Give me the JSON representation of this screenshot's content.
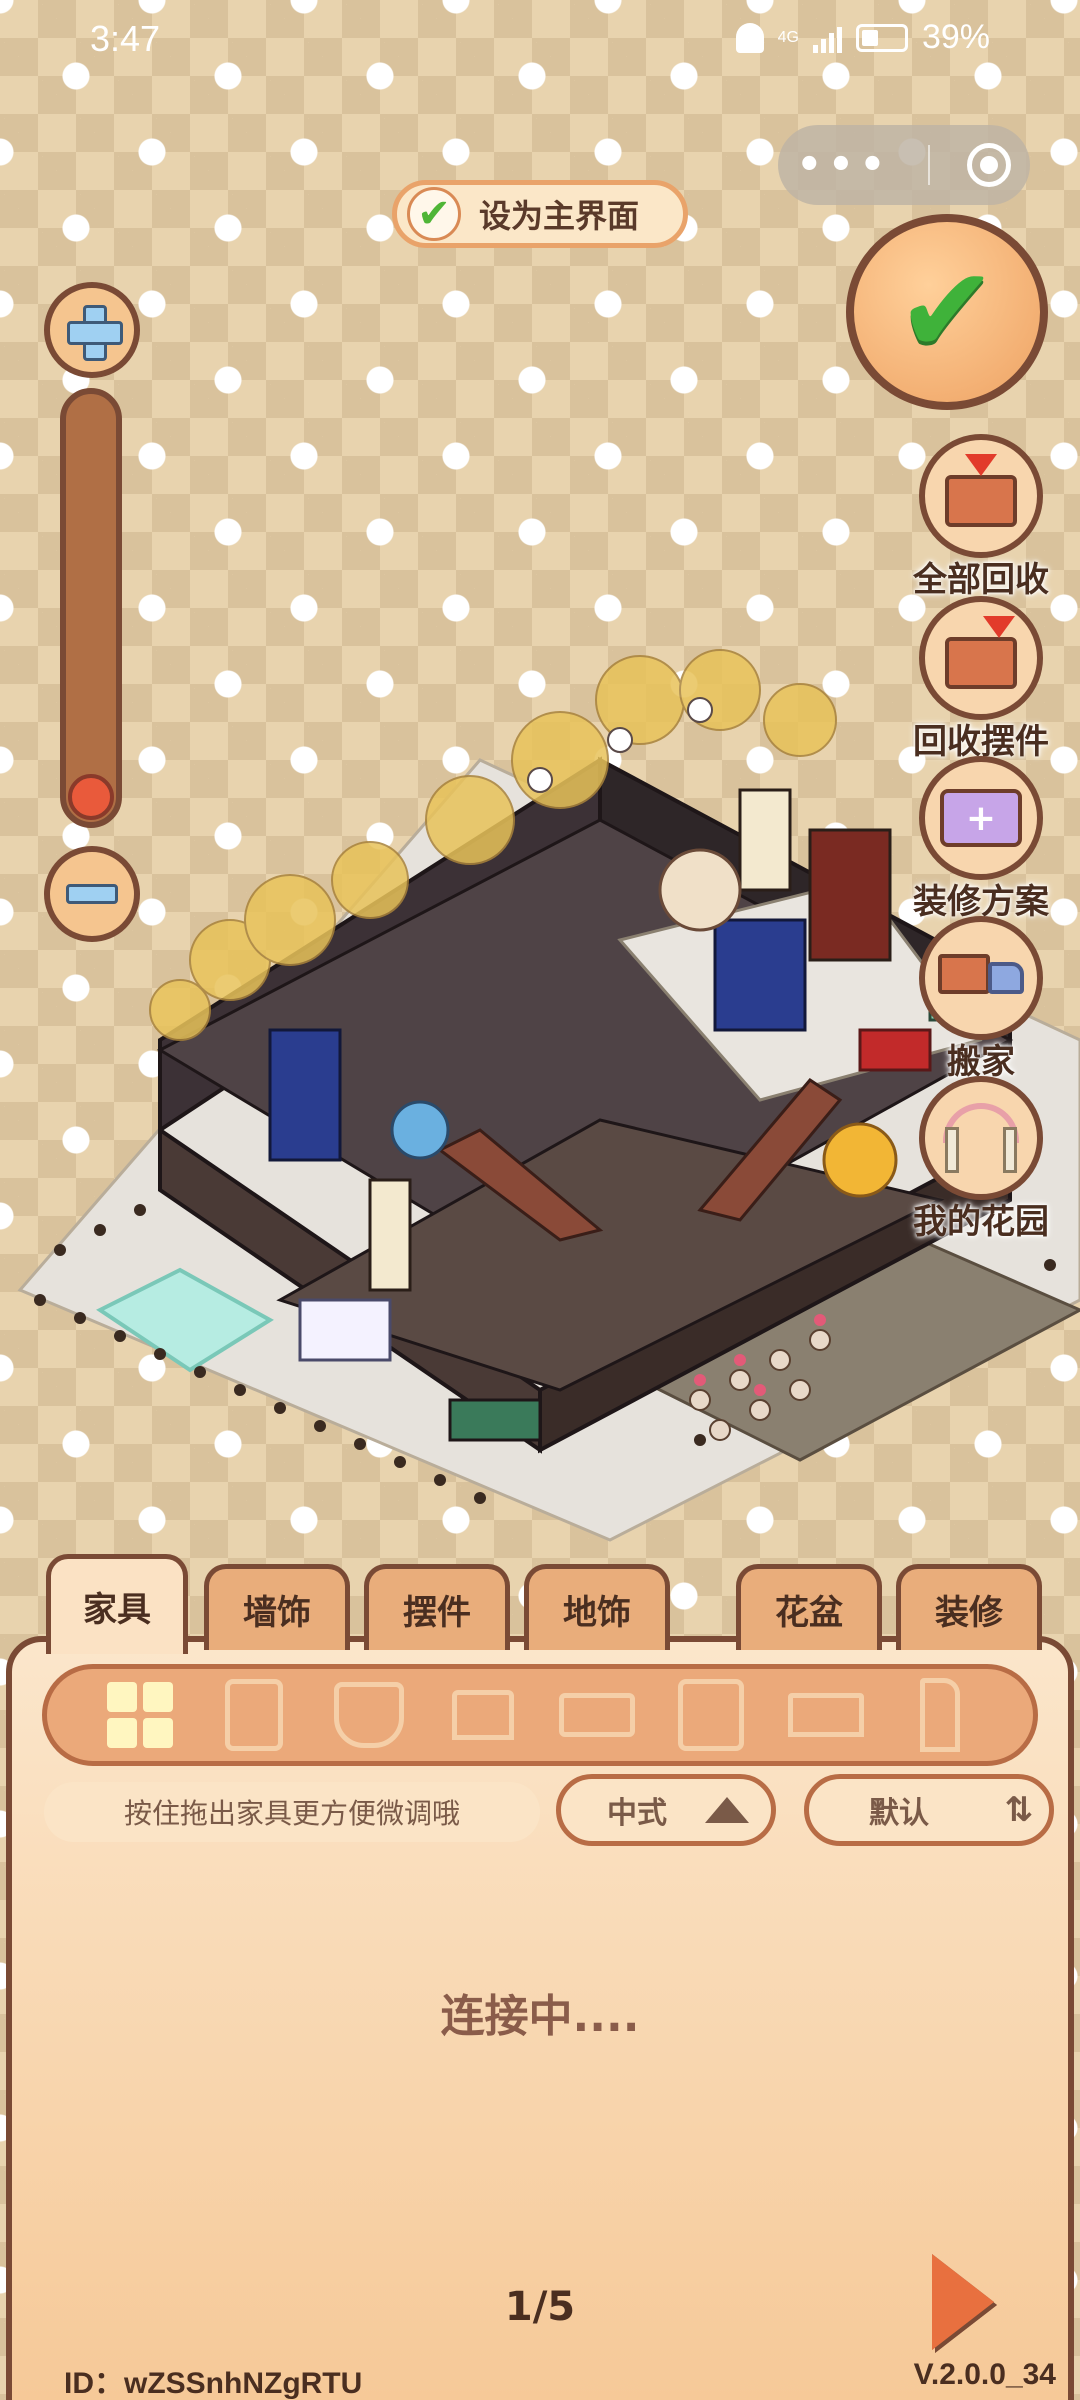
{
  "status_bar": {
    "time": "3:47",
    "network": "4G",
    "battery": "39%"
  },
  "header": {
    "set_main_label": "设为主界面"
  },
  "side_actions": [
    {
      "label": "全部回收",
      "icon": "recycle-all-icon"
    },
    {
      "label": "回收摆件",
      "icon": "recycle-decor-icon"
    },
    {
      "label": "装修方案",
      "icon": "renovation-plan-icon"
    },
    {
      "label": "搬家",
      "icon": "move-truck-icon"
    },
    {
      "label": "我的花园",
      "icon": "garden-arch-icon"
    }
  ],
  "tabs": [
    {
      "label": "家具",
      "active": true
    },
    {
      "label": "墙饰",
      "active": false
    },
    {
      "label": "摆件",
      "active": false
    },
    {
      "label": "地饰",
      "active": false
    },
    {
      "label": "花盆",
      "active": false
    },
    {
      "label": "装修",
      "active": false
    }
  ],
  "categories": [
    "all-grid-icon",
    "fridge-icon",
    "toilet-icon",
    "stool-icon",
    "bed-icon",
    "cabinet-icon",
    "table-icon",
    "lamp-icon"
  ],
  "filter": {
    "hint": "按住拖出家具更方便微调哦",
    "style_value": "中式",
    "sort_value": "默认"
  },
  "content": {
    "loading_text": "连接中...."
  },
  "pagination": {
    "page_label": "1/5"
  },
  "footer": {
    "user_id": "ID：wZSSnhNZgRTU",
    "version": "V.2.0.0_34"
  },
  "colors": {
    "panel_bg": "#fbe6cb",
    "border": "#7a4a35",
    "confirm_green": "#3fb23a",
    "knob_red": "#e95a3b"
  }
}
